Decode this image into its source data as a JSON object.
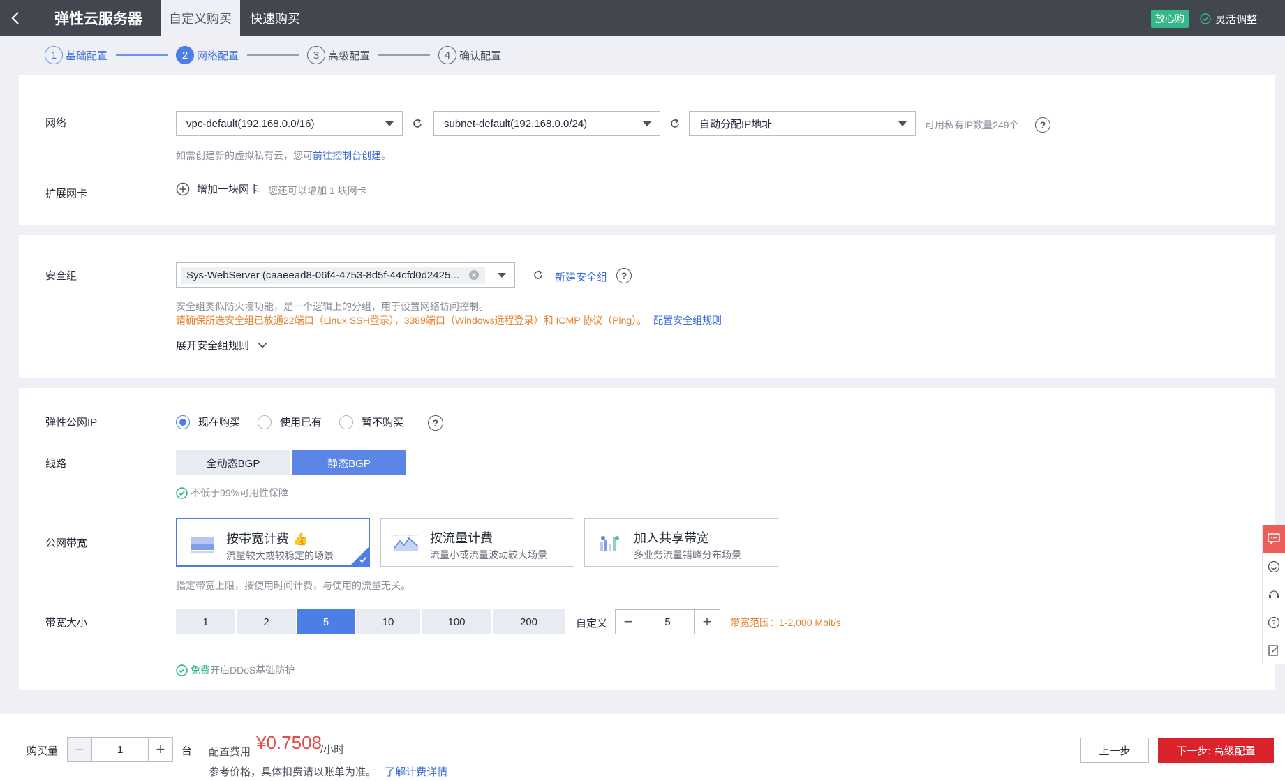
{
  "header": {
    "back_label": "返回",
    "title": "弹性云服务器",
    "tabs": [
      {
        "label": "自定义购买",
        "active": true
      },
      {
        "label": "快速购买",
        "active": false
      }
    ],
    "badge": "放心购",
    "flex_adjust": "灵活调整"
  },
  "stepper": {
    "steps": [
      {
        "num": "1",
        "label": "基础配置",
        "state": "done"
      },
      {
        "num": "2",
        "label": "网络配置",
        "state": "active"
      },
      {
        "num": "3",
        "label": "高级配置",
        "state": "todo"
      },
      {
        "num": "4",
        "label": "确认配置",
        "state": "todo"
      }
    ]
  },
  "network": {
    "label": "网络",
    "vpc": "vpc-default(192.168.0.0/16)",
    "subnet": "subnet-default(192.168.0.0/24)",
    "ip_mode": "自动分配IP地址",
    "available_ip": "可用私有IP数量249个",
    "hint_prefix": "如需创建新的虚拟私有云，您可",
    "hint_link": "前往控制台创建",
    "hint_suffix": "。",
    "ext_nic_label": "扩展网卡",
    "add_nic": "增加一块网卡",
    "add_nic_hint": "您还可以增加 1 块网卡"
  },
  "security": {
    "label": "安全组",
    "selected": "Sys-WebServer (caaeead8-06f4-4753-8d5f-44cfd0d2425...",
    "new_group": "新建安全组",
    "hint": "安全组类似防火墙功能，是一个逻辑上的分组，用于设置网络访问控制。",
    "warning": "请确保所选安全组已放通22端口（Linux SSH登录），3389端口（Windows远程登录）和 ICMP 协议（Ping）。",
    "config_link": "配置安全组规则",
    "expand": "展开安全组规则"
  },
  "eip": {
    "label": "弹性公网IP",
    "options": [
      {
        "label": "现在购买",
        "selected": true
      },
      {
        "label": "使用已有",
        "selected": false
      },
      {
        "label": "暂不购买",
        "selected": false
      }
    ],
    "line_label": "线路",
    "lines": [
      {
        "label": "全动态BGP",
        "selected": false
      },
      {
        "label": "静态BGP",
        "selected": true
      }
    ],
    "sla": "不低于99%可用性保障",
    "bandwidth_label": "公网带宽",
    "billing": [
      {
        "title": "按带宽计费",
        "sub": "流量较大或较稳定的场景",
        "selected": true
      },
      {
        "title": "按流量计费",
        "sub": "流量小或流量波动较大场景",
        "selected": false
      },
      {
        "title": "加入共享带宽",
        "sub": "多业务流量错峰分布场景",
        "selected": false
      }
    ],
    "billing_hint": "指定带宽上限，按使用时间计费，与使用的流量无关。",
    "size_label": "带宽大小",
    "sizes": [
      {
        "label": "1",
        "selected": false
      },
      {
        "label": "2",
        "selected": false
      },
      {
        "label": "5",
        "selected": true
      },
      {
        "label": "10",
        "selected": false
      },
      {
        "label": "100",
        "selected": false
      },
      {
        "label": "200",
        "selected": false
      }
    ],
    "custom_label": "自定义",
    "custom_value": "5",
    "range": "带宽范围：1-2,000 Mbit/s",
    "ddos_free": "免费",
    "ddos": "开启DDoS基础防护"
  },
  "footer": {
    "qty_label": "购买量",
    "qty": "1",
    "unit": "台",
    "fee_label": "配置费用",
    "price": "¥0.7508",
    "price_unit": "/小时",
    "note": "参考价格，具体扣费请以账单为准。",
    "detail_link": "了解计费详情",
    "prev": "上一步",
    "next": "下一步: 高级配置"
  },
  "colors": {
    "primary": "#4c7ee6",
    "danger": "#d9222a",
    "warning": "#e6822e",
    "success": "#34b889",
    "header_bg": "#41464f"
  }
}
